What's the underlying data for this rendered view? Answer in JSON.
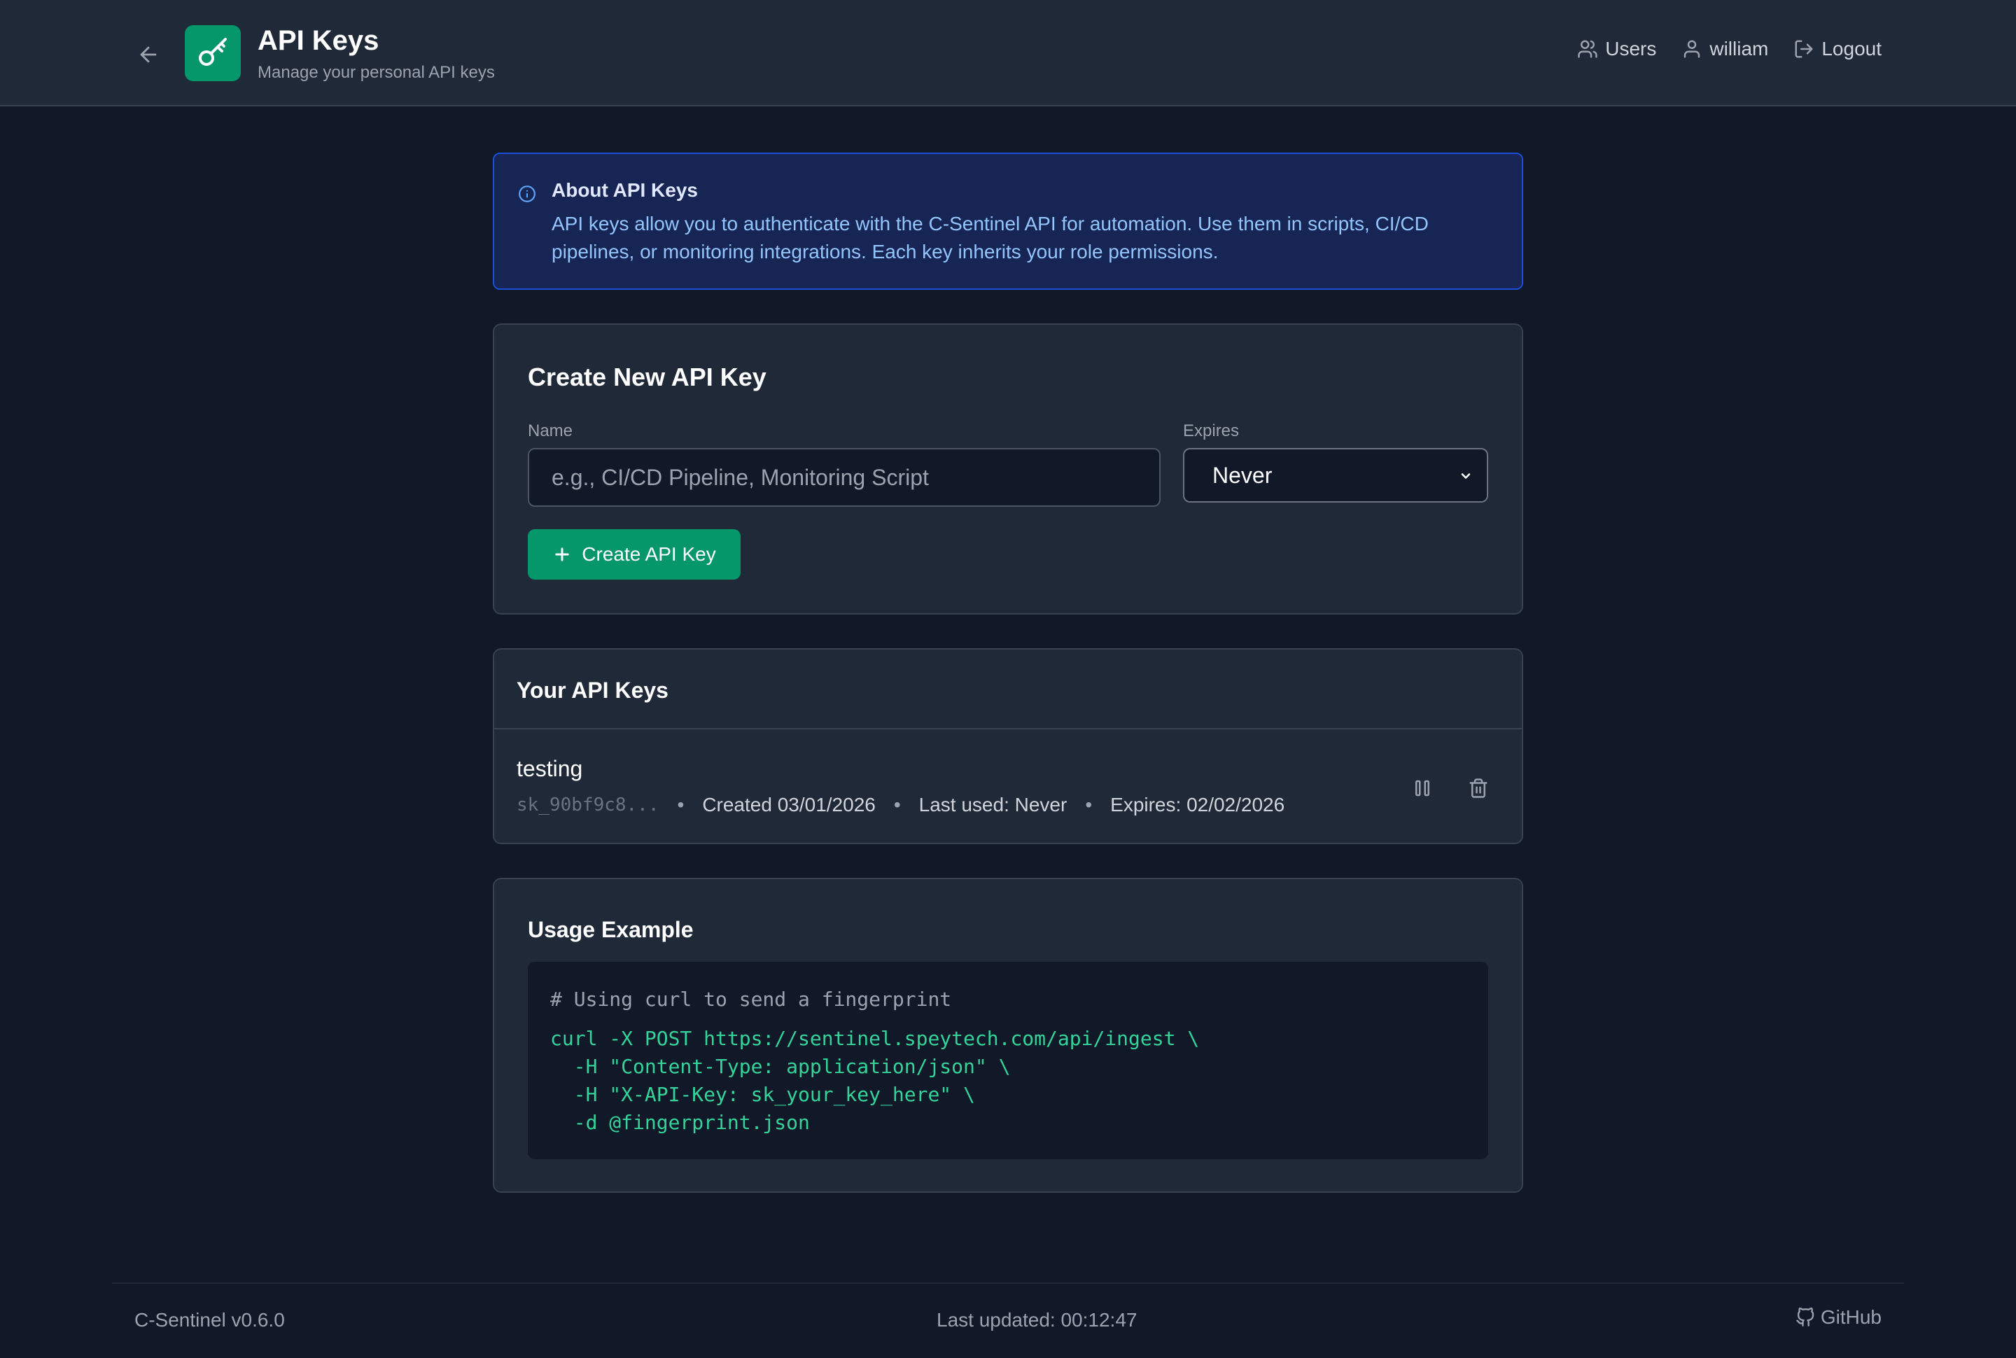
{
  "header": {
    "title": "API Keys",
    "subtitle": "Manage your personal API keys",
    "nav": {
      "users": "Users",
      "user": "william",
      "logout": "Logout"
    }
  },
  "info": {
    "title": "About API Keys",
    "text": "API keys allow you to authenticate with the C-Sentinel API for automation. Use them in scripts, CI/CD pipelines, or monitoring integrations. Each key inherits your role permissions."
  },
  "create": {
    "title": "Create New API Key",
    "name_label": "Name",
    "name_placeholder": "e.g., CI/CD Pipeline, Monitoring Script",
    "name_value": "",
    "expires_label": "Expires",
    "expires_value": "Never",
    "button_label": "Create API Key"
  },
  "keys": {
    "title": "Your API Keys",
    "items": [
      {
        "name": "testing",
        "prefix": "sk_90bf9c8...",
        "created": "Created 03/01/2026",
        "last_used": "Last used: Never",
        "expires": "Expires: 02/02/2026"
      }
    ]
  },
  "usage": {
    "title": "Usage Example",
    "comment": "# Using curl to send a fingerprint",
    "lines": [
      "curl -X POST https://sentinel.speytech.com/api/ingest \\",
      "  -H \"Content-Type: application/json\" \\",
      "  -H \"X-API-Key: sk_your_key_here\" \\",
      "  -d @fingerprint.json"
    ]
  },
  "footer": {
    "version": "C-Sentinel v0.6.0",
    "last_updated": "Last updated: 00:12:47",
    "github": "GitHub"
  },
  "colors": {
    "background": "#111827",
    "surface": "#1f2937",
    "accent": "#059669",
    "info_bg": "#172554",
    "info_border": "#1d4ed8",
    "code_green": "#34d399"
  }
}
